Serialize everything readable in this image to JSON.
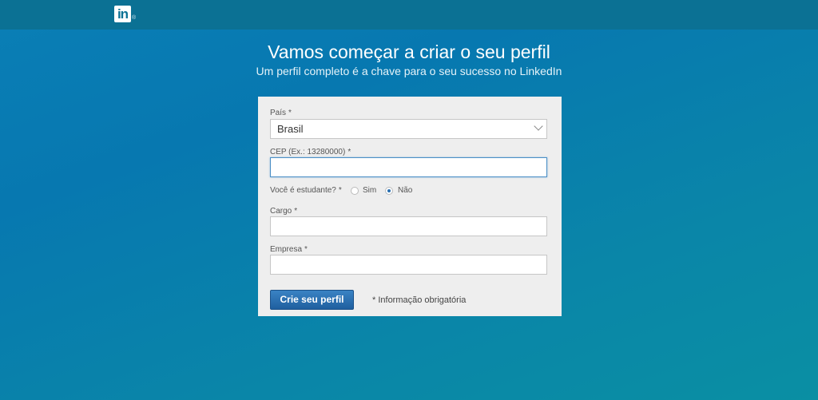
{
  "header": {
    "logo_text": "in",
    "logo_registered": "®"
  },
  "hero": {
    "title": "Vamos começar a criar o seu perfil",
    "subtitle": "Um perfil completo é a chave para o seu sucesso no LinkedIn"
  },
  "form": {
    "country_label": "País",
    "country_value": "Brasil",
    "cep_label": "CEP (Ex.: 13280000)",
    "cep_value": "",
    "student_label": "Você é estudante?",
    "student_options": [
      "Sim",
      "Não"
    ],
    "student_selected": "Não",
    "cargo_label": "Cargo",
    "cargo_value": "",
    "empresa_label": "Empresa",
    "empresa_value": "",
    "required_mark": "*",
    "submit_label": "Crie seu perfil",
    "required_note": "* Informação obrigatória"
  }
}
